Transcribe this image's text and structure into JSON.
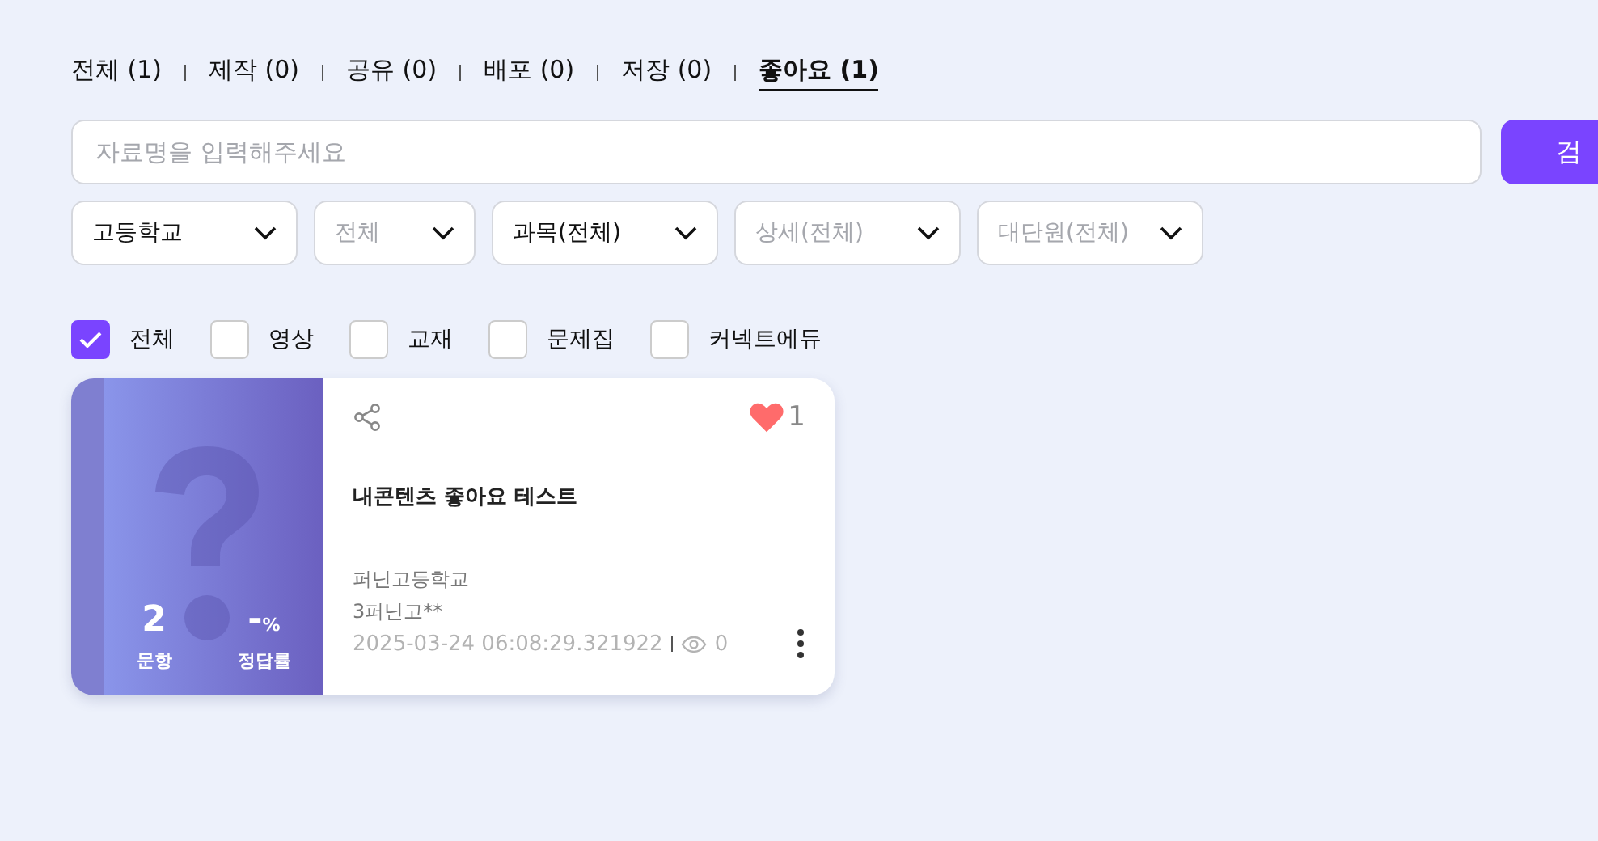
{
  "tabs": [
    {
      "label": "전체 (1)",
      "selected": false
    },
    {
      "label": "제작 (0)",
      "selected": false
    },
    {
      "label": "공유 (0)",
      "selected": false
    },
    {
      "label": "배포 (0)",
      "selected": false
    },
    {
      "label": "저장 (0)",
      "selected": false
    },
    {
      "label": "좋아요 (1)",
      "selected": true
    }
  ],
  "search": {
    "placeholder": "자료명을 입력해주세요",
    "button": "검"
  },
  "filters": [
    {
      "value": "고등학교"
    },
    {
      "placeholder": "전체"
    },
    {
      "value": "과목(전체)"
    },
    {
      "placeholder": "상세(전체)"
    },
    {
      "placeholder": "대단원(전체)"
    }
  ],
  "types": [
    {
      "label": "전체",
      "checked": true
    },
    {
      "label": "영상",
      "checked": false
    },
    {
      "label": "교재",
      "checked": false
    },
    {
      "label": "문제집",
      "checked": false
    },
    {
      "label": "커넥트에듀",
      "checked": false
    }
  ],
  "cards": [
    {
      "count": "2",
      "count_label": "문항",
      "rate": "-",
      "rate_unit": "%",
      "rate_label": "정답률",
      "liked": true,
      "likes": "1",
      "title": "내콘텐츠 좋아요 테스트",
      "school": "퍼닌고등학교",
      "author": "3퍼닌고**",
      "date": "2025-03-24 06:08:29.321922",
      "views": "0"
    }
  ]
}
